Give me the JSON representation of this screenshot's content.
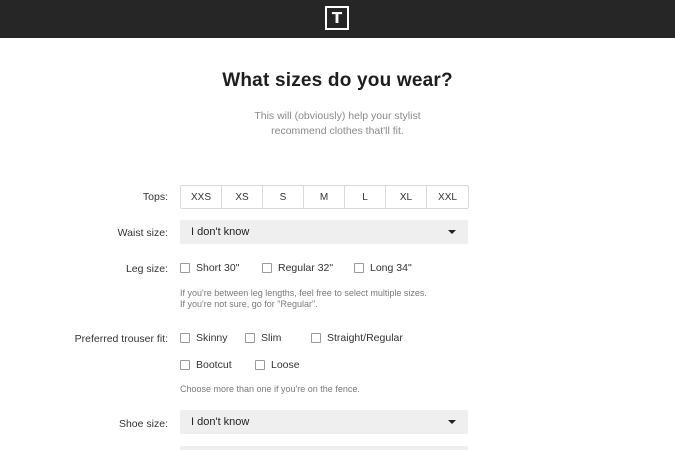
{
  "header": {
    "logo_letter": "T"
  },
  "page": {
    "title": "What sizes do you wear?",
    "subtitle_line1": "This will (obviously) help your stylist",
    "subtitle_line2": "recommend clothes that'll fit."
  },
  "tops": {
    "label": "Tops:",
    "options": [
      "XXS",
      "XS",
      "S",
      "M",
      "L",
      "XL",
      "XXL"
    ]
  },
  "waist": {
    "label": "Waist size:",
    "selected": "I don't know"
  },
  "leg": {
    "label": "Leg size:",
    "options": [
      "Short 30\"",
      "Regular 32\"",
      "Long 34\""
    ],
    "hint_line1": "If you're between leg lengths, feel free to select multiple sizes.",
    "hint_line2": "If you're not sure, go for \"Regular\"."
  },
  "trouser_fit": {
    "label": "Preferred trouser fit:",
    "options": [
      "Skinny",
      "Slim",
      "Straight/Regular",
      "Bootcut",
      "Loose"
    ],
    "hint": "Choose more than one if you're on the fence."
  },
  "shoe": {
    "label": "Shoe size:",
    "selected": "I don't know"
  }
}
